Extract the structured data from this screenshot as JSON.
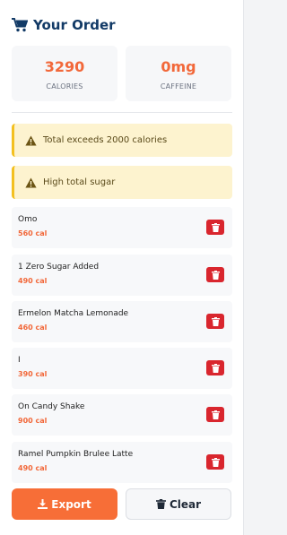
{
  "header": {
    "title": "Your Order",
    "icon": "cart-icon"
  },
  "stats": {
    "calories": {
      "value": "3290",
      "label": "CALORIES"
    },
    "caffeine": {
      "value": "0mg",
      "label": "CAFFEINE"
    }
  },
  "warnings": [
    {
      "text": "Total exceeds 2000 calories",
      "icon": "warning-icon"
    },
    {
      "text": "High total sugar",
      "icon": "warning-icon"
    }
  ],
  "items": [
    {
      "name": "Omo",
      "calories": "560 cal"
    },
    {
      "name": "1 Zero Sugar Added",
      "calories": "490 cal"
    },
    {
      "name": "Ermelon Matcha Lemonade",
      "calories": "460 cal"
    },
    {
      "name": "I",
      "calories": "390 cal"
    },
    {
      "name": "On Candy Shake",
      "calories": "900 cal"
    },
    {
      "name": "Ramel Pumpkin Brulee Latte",
      "calories": "490 cal"
    }
  ],
  "actions": {
    "export_label": "Export",
    "clear_label": "Clear"
  },
  "colors": {
    "accent": "#f2683a",
    "title": "#123a66",
    "warning_bg": "#fdf3cf",
    "warning_border": "#f3c020",
    "delete": "#d9262e"
  }
}
